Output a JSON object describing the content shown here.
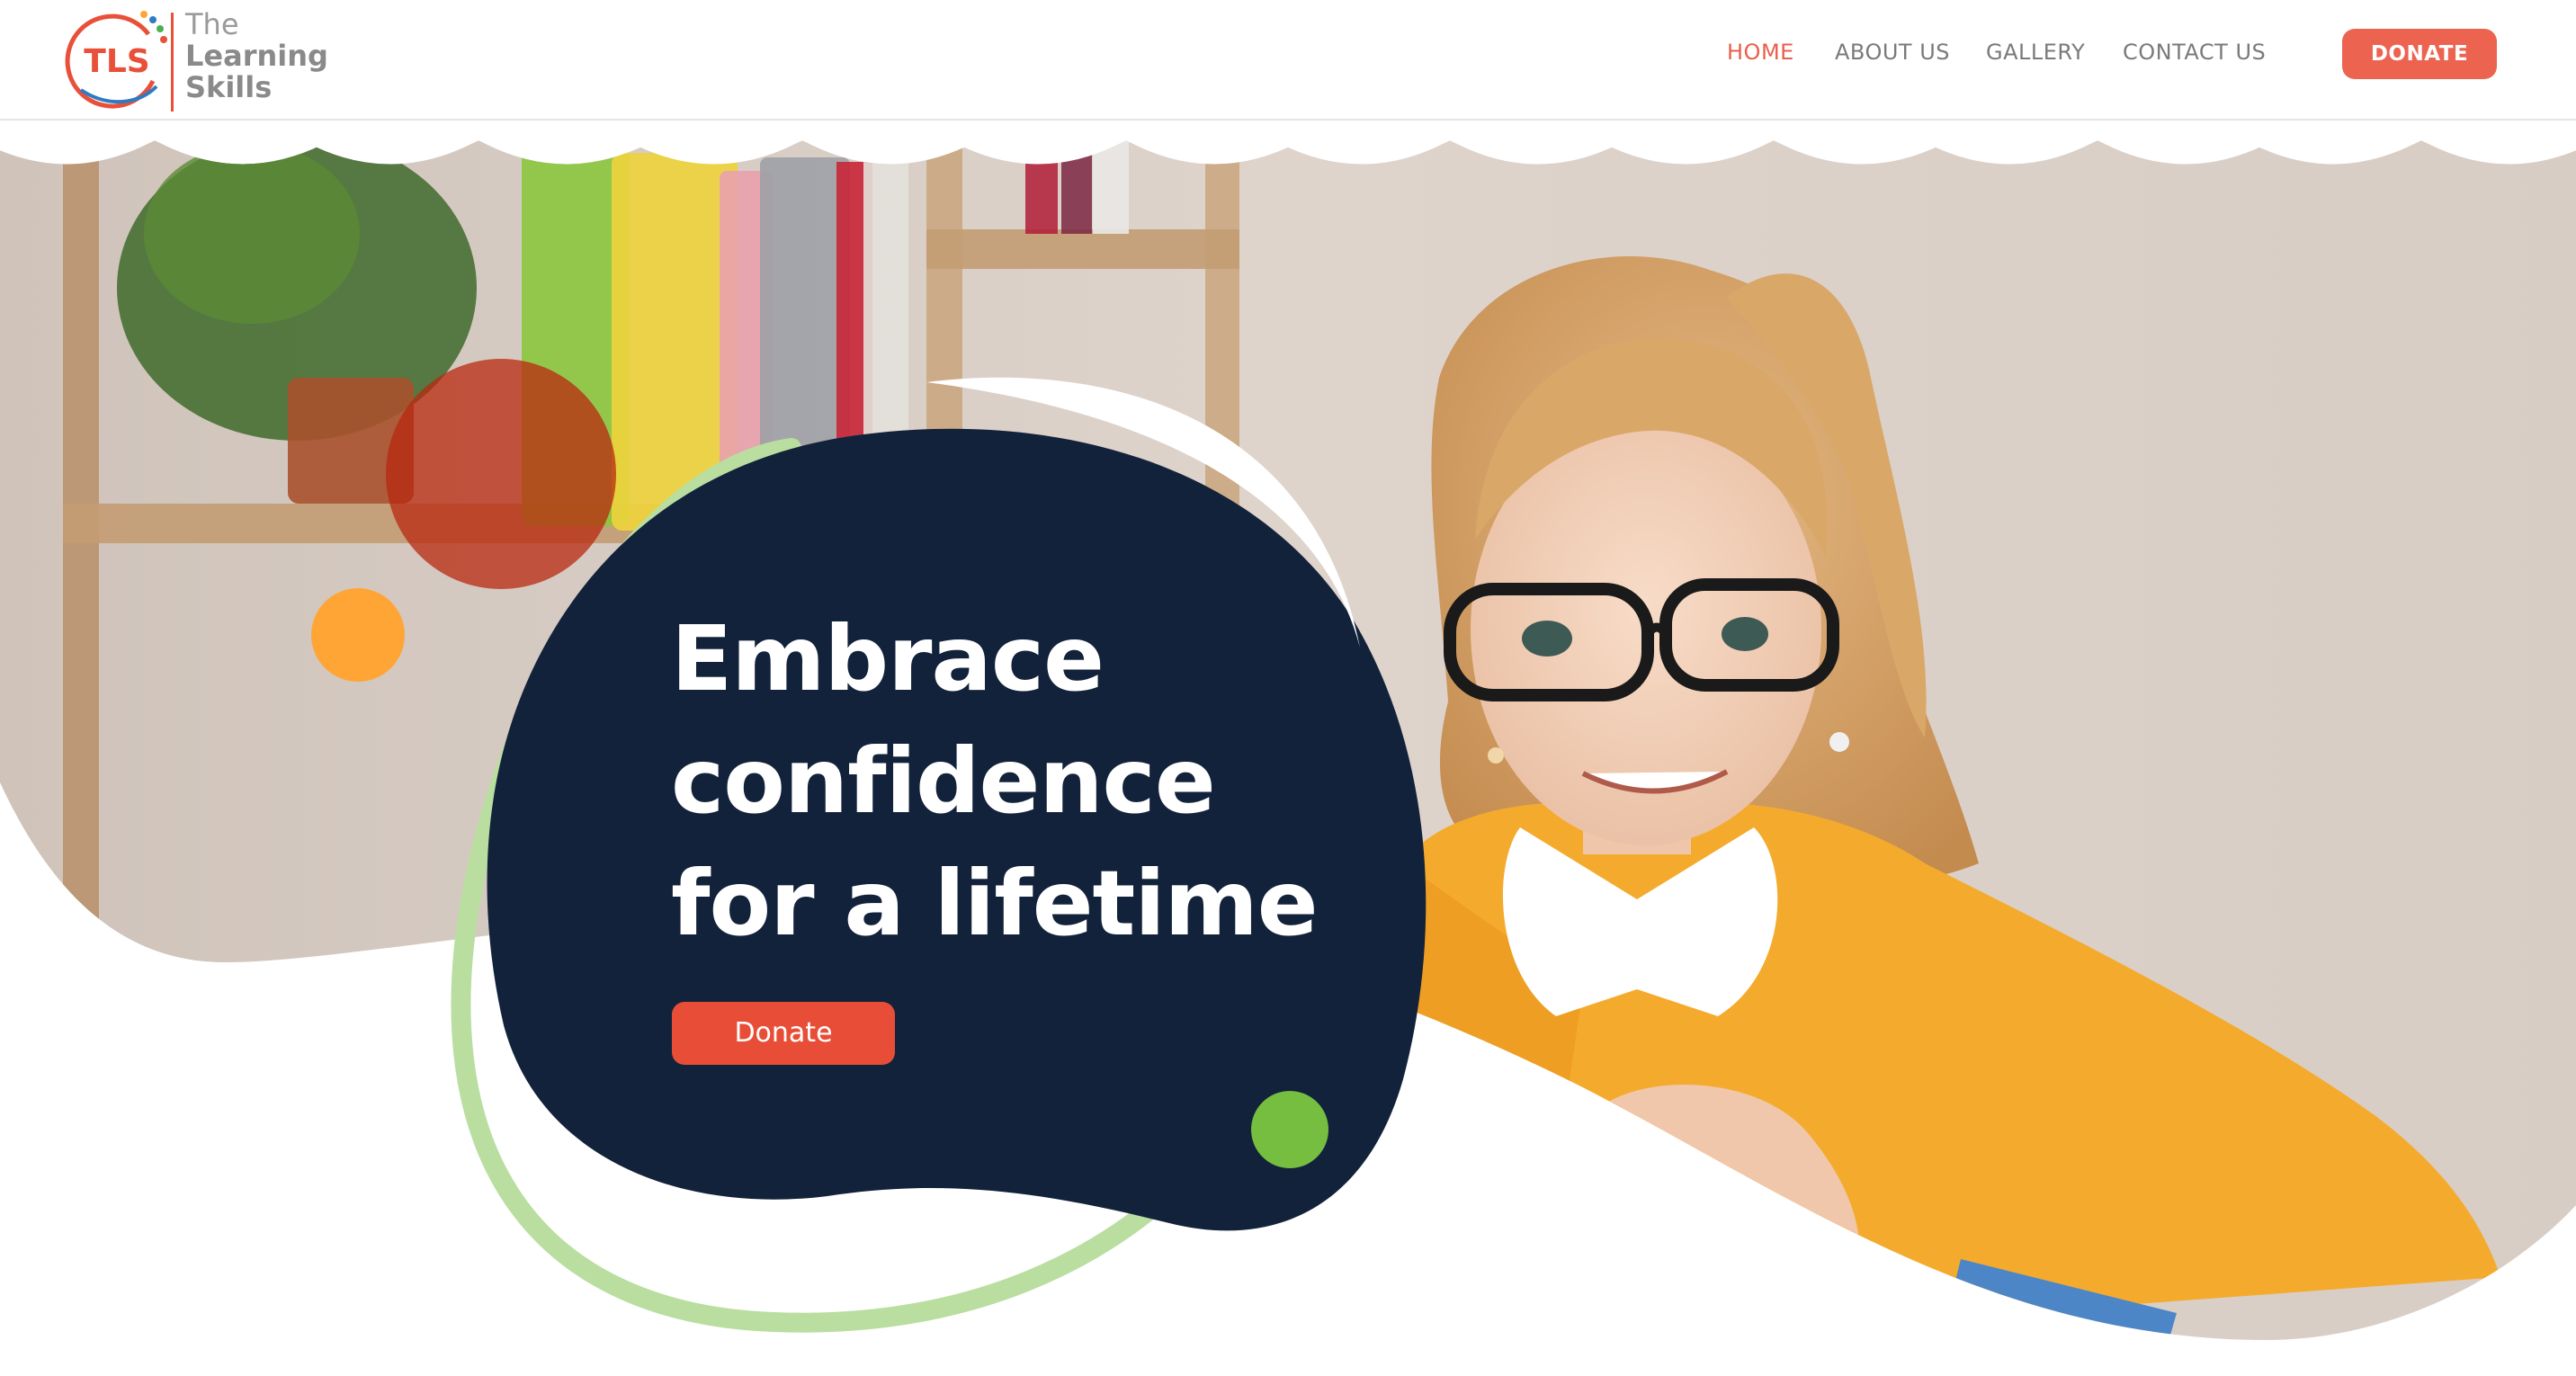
{
  "brand": {
    "mark_text": "TLS",
    "name_lines": [
      "The",
      "Learning",
      "Skills"
    ],
    "colors": {
      "red": "#e8503a",
      "blue": "#2e7bc4",
      "green": "#4caf50",
      "grey": "#8a8a8a"
    }
  },
  "nav": {
    "items": [
      {
        "label": "HOME",
        "active": true
      },
      {
        "label": "ABOUT US",
        "active": false
      },
      {
        "label": "GALLERY",
        "active": false
      },
      {
        "label": "CONTACT US",
        "active": false
      }
    ],
    "donate_label": "DONATE"
  },
  "hero": {
    "headline_lines": [
      "Embrace",
      "confidence",
      "for a lifetime"
    ],
    "donate_label": "Donate",
    "photo_description_icon": "girl-with-glasses-photo",
    "colors": {
      "blob": "#13223b",
      "accent_red": "#e84e37",
      "orange_dot": "#ffa536",
      "green_dot": "#76be40",
      "green_ring": "#b9dea0",
      "red_circle": "#b8280f"
    }
  }
}
